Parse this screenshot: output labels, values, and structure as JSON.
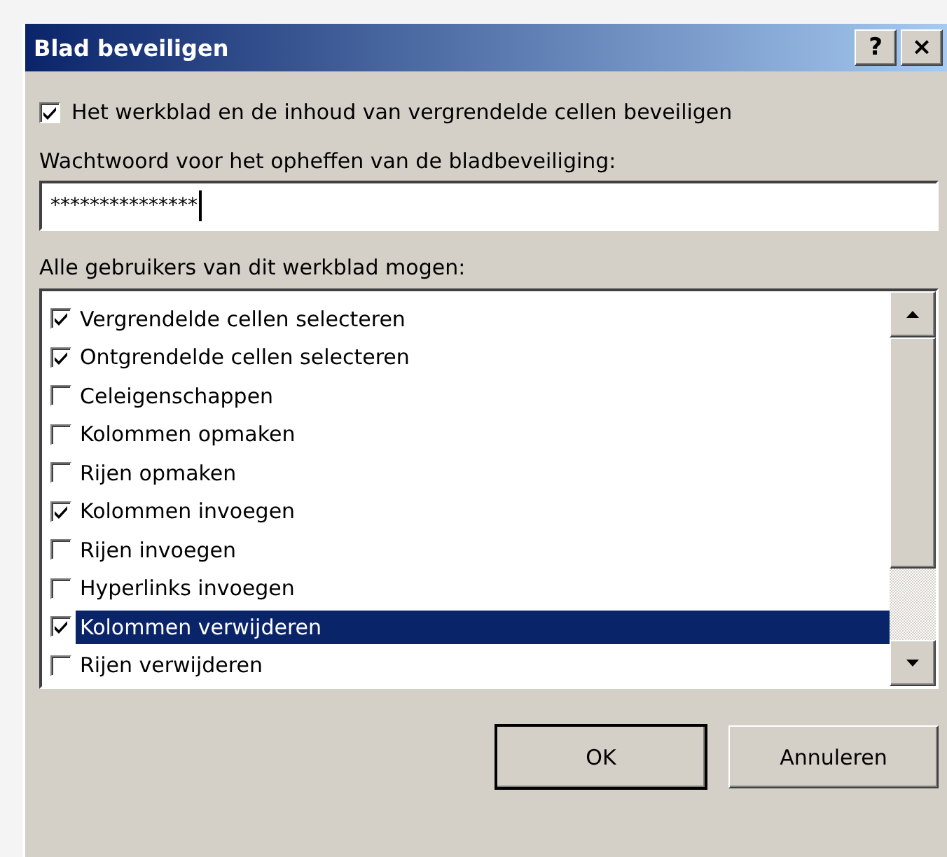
{
  "window": {
    "title": "Blad beveiligen",
    "help_button": "?",
    "close_button": "×"
  },
  "protect_option": {
    "label": "Het werkblad en de inhoud van vergrendelde cellen beveiligen",
    "checked": true
  },
  "password": {
    "label": "Wachtwoord voor het opheffen van de bladbeveiliging:",
    "value": "***************"
  },
  "permissions_label": "Alle gebruikers van dit werkblad mogen:",
  "permissions": [
    {
      "label": "Vergrendelde cellen selecteren",
      "checked": true,
      "selected": false
    },
    {
      "label": "Ontgrendelde cellen selecteren",
      "checked": true,
      "selected": false
    },
    {
      "label": "Celeigenschappen",
      "checked": false,
      "selected": false
    },
    {
      "label": "Kolommen opmaken",
      "checked": false,
      "selected": false
    },
    {
      "label": "Rijen opmaken",
      "checked": false,
      "selected": false
    },
    {
      "label": "Kolommen invoegen",
      "checked": true,
      "selected": false
    },
    {
      "label": "Rijen invoegen",
      "checked": false,
      "selected": false
    },
    {
      "label": "Hyperlinks invoegen",
      "checked": false,
      "selected": false
    },
    {
      "label": "Kolommen verwijderen",
      "checked": true,
      "selected": true
    },
    {
      "label": "Rijen verwijderen",
      "checked": false,
      "selected": false
    }
  ],
  "buttons": [
    "OK",
    "Annuleren"
  ]
}
